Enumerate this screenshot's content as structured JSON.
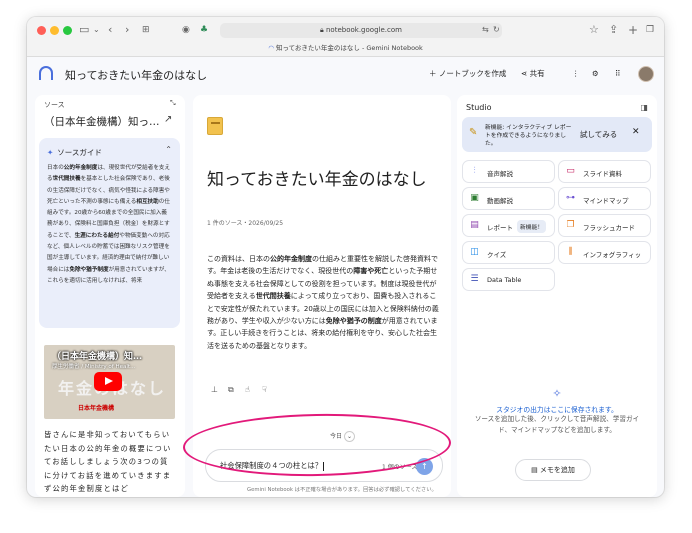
{
  "browser": {
    "url": "notebook.google.com",
    "tab_title": "知っておきたい年金のはなし - Gemini Notebook"
  },
  "header": {
    "title": "知っておきたい年金のはなし",
    "create_notebook": "ノートブックを作成",
    "share": "共有"
  },
  "sources": {
    "panel_label": "ソース",
    "source_name": "（日本年金機構）知っ…",
    "guide_title": "ソースガイド",
    "guide_paragraph": [
      [
        "日本の",
        "公的年金制度",
        "は、現役世代が受給者を支える",
        "世代間扶養",
        "を基本とした社会保険であり、老後の生活保障だけでなく、病気や怪我による障害や死亡といった不測の事態にも備える",
        "相互扶助",
        "の仕組みです。20歳から60歳までの全国民に加入義務があり、保険料と国庫負担（税金）を財源とすることで、",
        "生涯にわたる給付",
        "や物価変動への対応など、個人レベルの貯蓄では困難なリスク管理を国が主導しています。経済的理由で納付が難しい場合には",
        "免除や猶予制度",
        "が用意されていますが、これらを適切に活用しなければ、将来"
      ]
    ],
    "video": {
      "title": "（日本年金機構）知…",
      "subtitle": "厚生労働省 / Ministry of Healt…",
      "caption": "年金のはなし",
      "logo": "日本年金機構"
    },
    "transcript": "皆さんに是非知っておいてもらいたい日本の公的年金の概要についてお話ししましょう次の3つの質に分けてお話を進めていきますまず公的年金制度とはど"
  },
  "chat": {
    "notebook_title": "知っておきたい年金のはなし",
    "meta": "1 件のソース・2026/09/25",
    "summary_parts": [
      "この資料は、日本の",
      "公的年金制度",
      "の仕組みと重要性を解説した啓発資料です。年金は老後の生活だけでなく、現役世代の",
      "障害や死亡",
      "といった予期せぬ事態を支える社会保障としての役割を担っています。制度は現役世代が受給者を支える",
      "世代間扶養",
      "によって成り立っており、国費も投入されることで安定性が保たれています。20歳以上の国民には加入と保険料納付の義務があり、学生や収入が少ない方には",
      "免除や猶予の制度",
      "が用意されています。正しい手続きを行うことは、将来の給付権利を守り、安心した社会生活を送るための基盤となります。"
    ],
    "today_label": "今日",
    "input_value": "社会保障制度の４つの柱とは？",
    "source_count": "1 個のソース",
    "disclaimer": "Gemini Notebook は不正確な場合があります。回答は必ず確認してください。"
  },
  "studio": {
    "panel_label": "Studio",
    "banner_text": "新機能: インタラクティブ レポートを作成できるようになりました。",
    "banner_try": "試してみる",
    "tiles": [
      {
        "label": "音声解説",
        "icon": "audio-icon",
        "color": "#5b6ee8"
      },
      {
        "label": "スライド資料",
        "icon": "slides-icon",
        "color": "#c2185b"
      },
      {
        "label": "動画解説",
        "icon": "video-icon",
        "color": "#2e7d32"
      },
      {
        "label": "マインドマップ",
        "icon": "mindmap-icon",
        "color": "#6a4fd1"
      },
      {
        "label": "レポート",
        "icon": "report-icon",
        "color": "#8e44ad",
        "badge": "新機能！"
      },
      {
        "label": "フラッシュカード",
        "icon": "flashcard-icon",
        "color": "#e67e22"
      },
      {
        "label": "クイズ",
        "icon": "quiz-icon",
        "color": "#1e88e5"
      },
      {
        "label": "インフォグラフィッ",
        "icon": "infographic-icon",
        "color": "#e67e22"
      },
      {
        "label": "Data Table",
        "icon": "table-icon",
        "color": "#3f51b5"
      }
    ],
    "empty_title": "スタジオの出力はここに保存されます。",
    "empty_desc": "ソースを追加した後、クリックして音声解説、学習ガイド、マインドマップなどを追加します。",
    "add_memo": "メモを追加"
  }
}
